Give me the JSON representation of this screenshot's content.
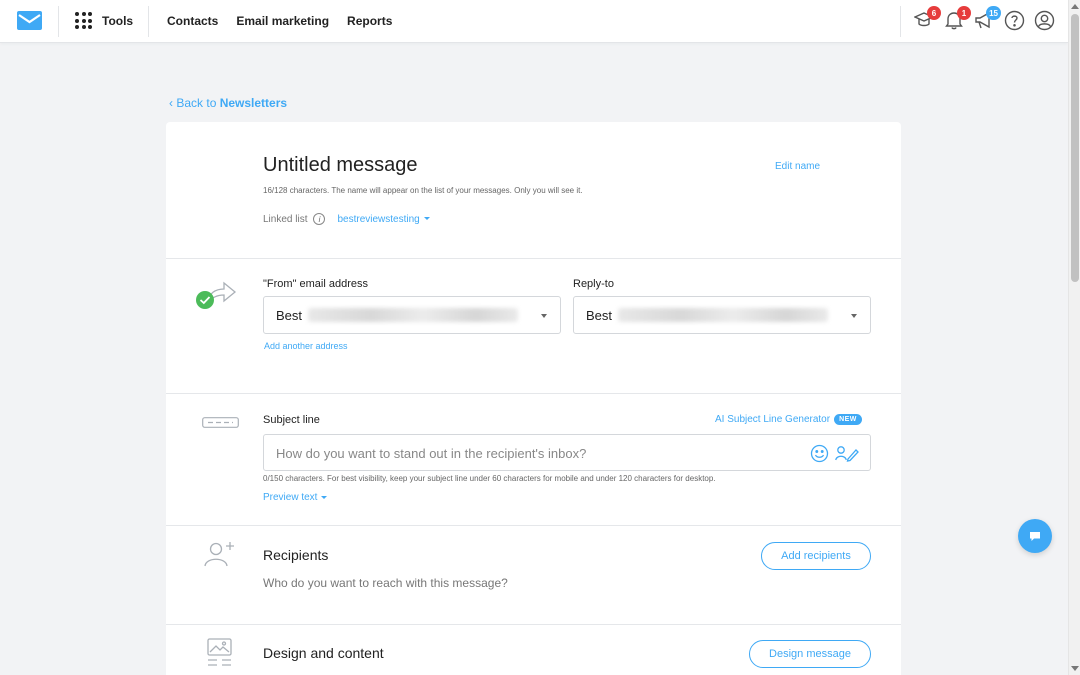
{
  "nav": {
    "tools_label": "Tools",
    "menu": [
      "Contacts",
      "Email marketing",
      "Reports"
    ],
    "badges": {
      "graduation": "6",
      "bell": "1",
      "megaphone": "15"
    }
  },
  "back": {
    "prefix": "Back to ",
    "target": "Newsletters"
  },
  "message": {
    "title": "Untitled message",
    "edit_name": "Edit name",
    "char_hint": "16/128 characters. The name will appear on the list of your messages. Only you will see it.",
    "linked_list_label": "Linked list",
    "linked_list_value": "bestreviewstesting"
  },
  "sender": {
    "from_label": "\"From\" email address",
    "from_value": "Best",
    "reply_label": "Reply-to",
    "reply_value": "Best",
    "add_address": "Add another address"
  },
  "subject": {
    "label": "Subject line",
    "ai_generator": "AI Subject Line Generator",
    "new_badge": "NEW",
    "placeholder": "How do you want to stand out in the recipient's inbox?",
    "char_hint": "0/150 characters. For best visibility, keep your subject line under 60 characters for mobile and under 120 characters for desktop.",
    "preview_text": "Preview text"
  },
  "recipients": {
    "title": "Recipients",
    "subtitle": "Who do you want to reach with this message?",
    "button": "Add recipients"
  },
  "design": {
    "title": "Design and content",
    "button": "Design message"
  },
  "colors": {
    "accent": "#3fa9f5",
    "success": "#4cbb5a",
    "badge_red": "#e63c3c"
  }
}
